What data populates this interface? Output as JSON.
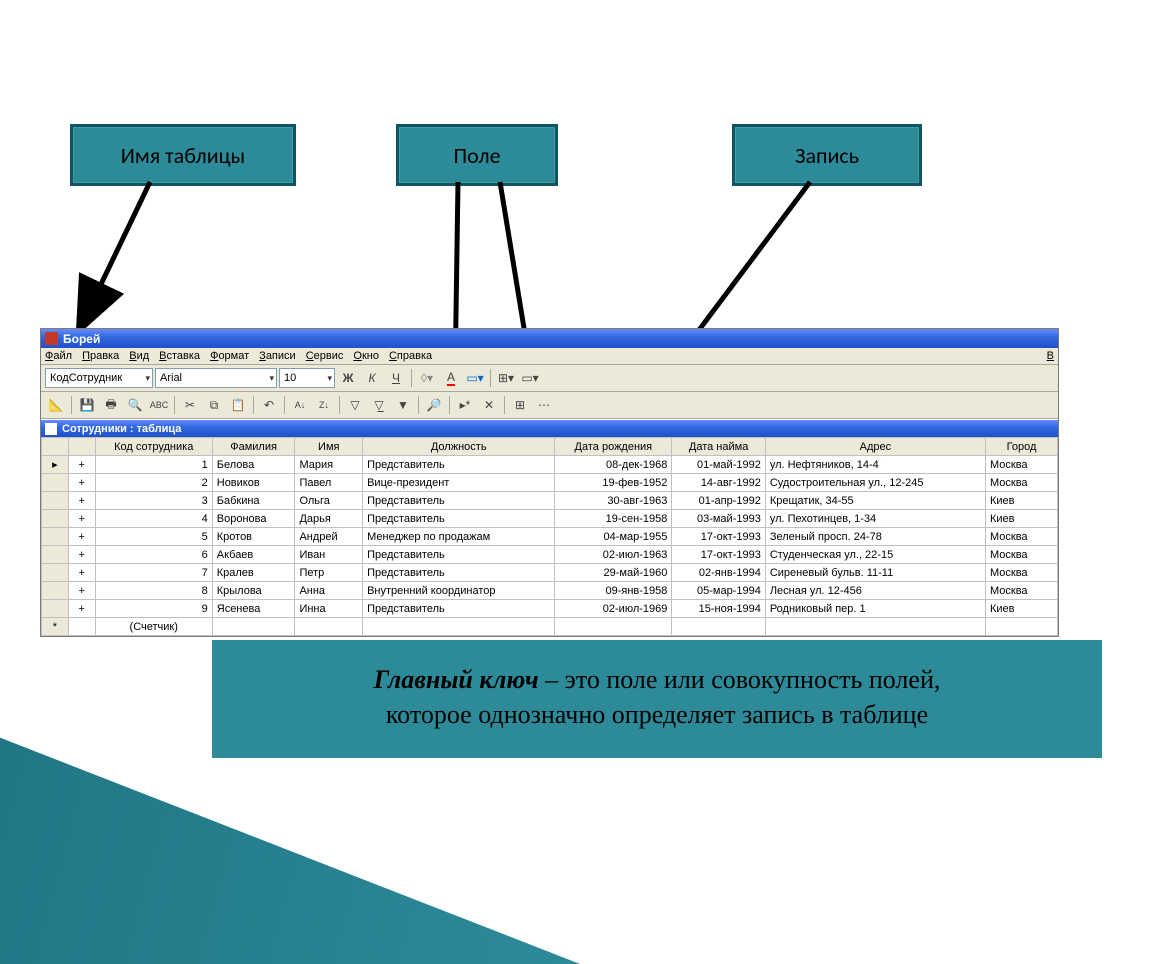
{
  "callouts": {
    "tableName": "Имя таблицы",
    "field": "Поле",
    "record": "Запись"
  },
  "app": {
    "title": "Борей",
    "menu": [
      "Файл",
      "Правка",
      "Вид",
      "Вставка",
      "Формат",
      "Записи",
      "Сервис",
      "Окно",
      "Справка"
    ],
    "rightMenu": "В",
    "format_toolbar": {
      "field_selector": "КодСотрудник",
      "font": "Arial",
      "size": "10"
    },
    "subwindow_title": "Сотрудники : таблица",
    "columns": [
      "Код сотрудника",
      "Фамилия",
      "Имя",
      "Должность",
      "Дата рождения",
      "Дата найма",
      "Адрес",
      "Город"
    ],
    "rows": [
      {
        "id": "1",
        "fam": "Белова",
        "name": "Мария",
        "pos": "Представитель",
        "birth": "08-дек-1968",
        "hire": "01-май-1992",
        "addr": "ул. Нефтяников, 14-4",
        "city": "Москва"
      },
      {
        "id": "2",
        "fam": "Новиков",
        "name": "Павел",
        "pos": "Вице-президент",
        "birth": "19-фев-1952",
        "hire": "14-авг-1992",
        "addr": "Судостроительная ул., 12-245",
        "city": "Москва"
      },
      {
        "id": "3",
        "fam": "Бабкина",
        "name": "Ольга",
        "pos": "Представитель",
        "birth": "30-авг-1963",
        "hire": "01-апр-1992",
        "addr": "Крещатик, 34-55",
        "city": "Киев"
      },
      {
        "id": "4",
        "fam": "Воронова",
        "name": "Дарья",
        "pos": "Представитель",
        "birth": "19-сен-1958",
        "hire": "03-май-1993",
        "addr": "ул. Пехотинцев, 1-34",
        "city": "Киев"
      },
      {
        "id": "5",
        "fam": "Кротов",
        "name": "Андрей",
        "pos": "Менеджер по продажам",
        "birth": "04-мар-1955",
        "hire": "17-окт-1993",
        "addr": "Зеленый просп. 24-78",
        "city": "Москва"
      },
      {
        "id": "6",
        "fam": "Акбаев",
        "name": "Иван",
        "pos": "Представитель",
        "birth": "02-июл-1963",
        "hire": "17-окт-1993",
        "addr": "Студенческая ул., 22-15",
        "city": "Москва"
      },
      {
        "id": "7",
        "fam": "Кралев",
        "name": "Петр",
        "pos": "Представитель",
        "birth": "29-май-1960",
        "hire": "02-янв-1994",
        "addr": "Сиреневый бульв. 11-11",
        "city": "Москва"
      },
      {
        "id": "8",
        "fam": "Крылова",
        "name": "Анна",
        "pos": "Внутренний координатор",
        "birth": "09-янв-1958",
        "hire": "05-мар-1994",
        "addr": "Лесная ул. 12-456",
        "city": "Москва"
      },
      {
        "id": "9",
        "fam": "Ясенева",
        "name": "Инна",
        "pos": "Представитель",
        "birth": "02-июл-1969",
        "hire": "15-ноя-1994",
        "addr": "Родниковый пер. 1",
        "city": "Киев"
      }
    ],
    "new_row_label": "(Счетчик)"
  },
  "definition": {
    "term": "Главный ключ",
    "rest1": " – это поле или совокупность полей,",
    "rest2": "которое однозначно определяет запись в таблице"
  }
}
